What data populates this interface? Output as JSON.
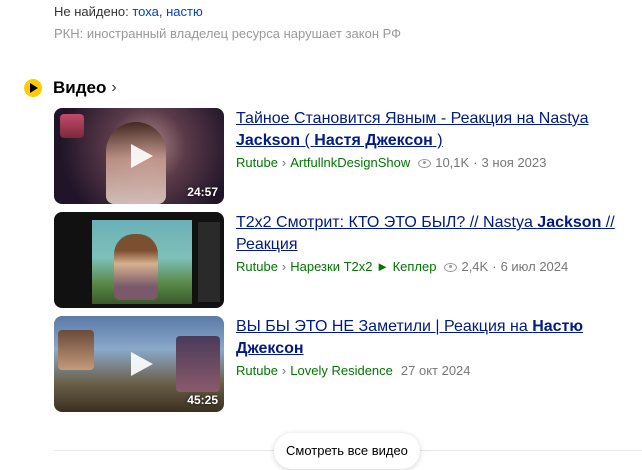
{
  "notfound": {
    "label": "Не найдено:",
    "words": [
      "тоха",
      "настю"
    ],
    "separator": ","
  },
  "rkn_notice": "РКН: иностранный владелец ресурса нарушает закон РФ",
  "video_section": {
    "title": "Видео",
    "chevron": "›"
  },
  "videos": [
    {
      "title_parts": [
        "Тайное Становится Явным - Реакция на Nastya ",
        "Jackson",
        " ( ",
        "Настя Джексон",
        " )"
      ],
      "duration": "24:57",
      "source": "Rutube",
      "channel": "ArtfullnkDesignShow",
      "views": "10,1K",
      "date": "3 ноя 2023"
    },
    {
      "title_parts": [
        "Т2х2 Смотрит: КТО ЭТО БЫЛ? // Nastya ",
        "Jackson",
        " // Реакция"
      ],
      "duration": "",
      "source": "Rutube",
      "channel": "Нарезки Т2х2 ► Кеплер",
      "views": "2,4K",
      "date": "6 июл 2024"
    },
    {
      "title_parts": [
        "ВЫ БЫ ЭТО НЕ Заметили | Реакция на ",
        "Настю Джексон"
      ],
      "duration": "45:25",
      "source": "Rutube",
      "channel": "Lovely Residence",
      "views": "",
      "date": "27 окт 2024"
    }
  ],
  "breadcrumb_sep": "›",
  "date_sep": "·",
  "see_all_label": "Смотреть все видео",
  "colors": {
    "link": "#001a86",
    "green": "#007700",
    "accent": "#ffcc00"
  }
}
